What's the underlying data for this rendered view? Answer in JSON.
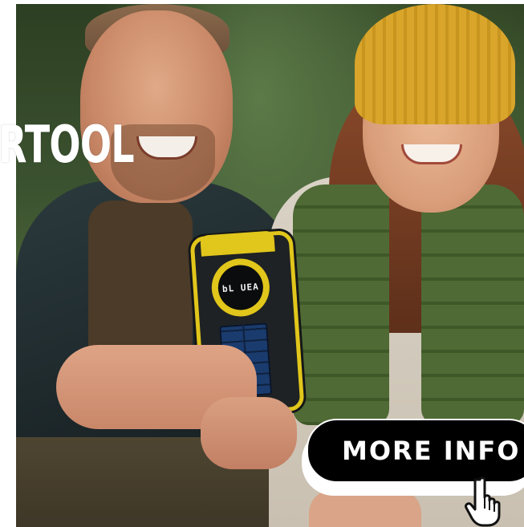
{
  "hero": {
    "headline": "RTOOL",
    "device_readout": "bL UEA"
  },
  "cta": {
    "label": "MORE INFO"
  },
  "colors": {
    "cta_background": "#000000",
    "cta_text": "#ffffff",
    "device_accent": "#e1c61b"
  },
  "icons": {
    "pointer": "hand-pointer-icon"
  }
}
